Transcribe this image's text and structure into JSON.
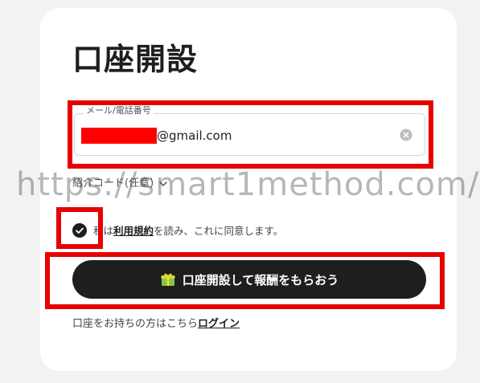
{
  "form": {
    "title": "口座開設",
    "field_label": "メール/電話番号",
    "field_value_suffix": "@gmail.com",
    "referral_label": "紹介コード(任意)",
    "consent_prefix": "私は",
    "terms_link": "利用規約",
    "consent_suffix": "を読み、これに同意します。",
    "submit_label": "口座開設して報酬をもらおう",
    "login_prompt": "口座をお持ちの方はこちら",
    "login_link": "ログイン"
  },
  "watermark": "https://smart1method.com/",
  "icons": [
    "clear-icon",
    "chevron-down-icon",
    "check-circle-icon",
    "gift-icon"
  ],
  "colors": {
    "highlight": "#e60000",
    "button": "#1e1e1e",
    "redaction": "#ff0000"
  }
}
